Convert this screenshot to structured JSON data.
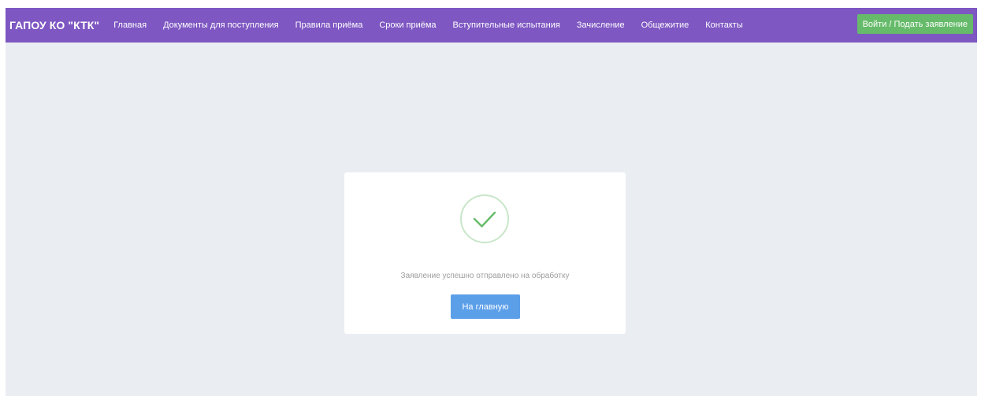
{
  "header": {
    "brand": "ГАПОУ КО \"КТК\"",
    "nav": [
      {
        "label": "Главная"
      },
      {
        "label": "Документы для поступления"
      },
      {
        "label": "Правила приёма"
      },
      {
        "label": "Сроки приёма"
      },
      {
        "label": "Вступительные испытания"
      },
      {
        "label": "Зачисление"
      },
      {
        "label": "Общежитие"
      },
      {
        "label": "Контакты"
      }
    ],
    "login_label": "Войти / Подать заявление"
  },
  "main": {
    "status_icon": "checkmark-circle",
    "message": "Заявление успешно отправлено на обработку",
    "home_button_label": "На главную"
  },
  "colors": {
    "navbar": "#7e57c2",
    "login_button": "#66bb6a",
    "home_button": "#5c9fe9",
    "success_check": "#66bb6a",
    "background": "#eaeef2"
  }
}
